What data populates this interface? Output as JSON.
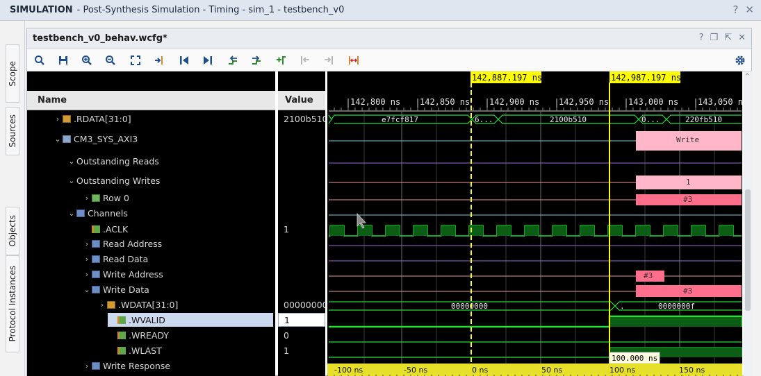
{
  "window": {
    "app": "SIMULATION",
    "rest": "- Post-Synthesis Simulation - Timing - sim_1 - testbench_v0",
    "help": "?",
    "close": "✕"
  },
  "left_tabs": [
    "Scope",
    "Sources",
    "Objects",
    "Protocol Instances"
  ],
  "panel": {
    "title": "testbench_v0_behav.wcfg*",
    "btn_help": "?",
    "btn_restore": "❐",
    "btn_float": "⇱",
    "btn_close": "✕"
  },
  "columns": {
    "name": "Name",
    "value": "Value"
  },
  "rows": [
    {
      "label": ".RDATA[31:0]",
      "value": "2100b510",
      "chevron": "›",
      "icon": "bus"
    },
    {
      "label": "CM3_SYS_AXI3",
      "value": "",
      "chevron": "⌄",
      "icon": "inst"
    },
    {
      "label": "Outstanding Reads",
      "value": "",
      "chevron": "⌄",
      "icon": ""
    },
    {
      "label": "Outstanding Writes",
      "value": "",
      "chevron": "⌄",
      "icon": ""
    },
    {
      "label": "Row 0",
      "value": "",
      "chevron": "›",
      "icon": "rowi"
    },
    {
      "label": "Channels",
      "value": "",
      "chevron": "⌄",
      "icon": "grp"
    },
    {
      "label": ".ACLK",
      "value": "1",
      "chevron": "",
      "icon": "bit"
    },
    {
      "label": "Read Address",
      "value": "",
      "chevron": "›",
      "icon": "grp"
    },
    {
      "label": "Read Data",
      "value": "",
      "chevron": "›",
      "icon": "grp"
    },
    {
      "label": "Write Address",
      "value": "",
      "chevron": "›",
      "icon": "grp"
    },
    {
      "label": "Write Data",
      "value": "",
      "chevron": "⌄",
      "icon": "grp"
    },
    {
      "label": ".WDATA[31:0]",
      "value": "00000000",
      "chevron": "›",
      "icon": "bus"
    },
    {
      "label": ".WVALID",
      "value": "1",
      "chevron": "",
      "icon": "bit",
      "selected": true
    },
    {
      "label": ".WREADY",
      "value": "0",
      "chevron": "",
      "icon": "bit"
    },
    {
      "label": ".WLAST",
      "value": "1",
      "chevron": "",
      "icon": "bit"
    },
    {
      "label": "Write Response",
      "value": "",
      "chevron": "›",
      "icon": "grp"
    }
  ],
  "cursors": {
    "main": "142,887.197 ns",
    "second": "142,987.197 ns",
    "delta": "100.000 ns"
  },
  "time_ticks": [
    "142,800 ns",
    "142,850 ns",
    "142,900 ns",
    "142,950 ns",
    "143,000 ns",
    "143,050 ns"
  ],
  "rel_ticks": [
    "-100 ns",
    "-50 ns",
    "0 ns",
    "50 ns",
    "100 ns",
    "150 ns"
  ],
  "wave_labels": {
    "rdata_a": "e7fcf817",
    "rdata_b": "6...",
    "rdata_c": "2100b510",
    "rdata_d": "0...",
    "rdata_e": "220fb510",
    "write_tx": "Write",
    "out_writes": "1",
    "row0": "#3",
    "wa": "#3",
    "wd": "#3",
    "wdata_a": "00000000",
    "wdata_b": ".",
    "wdata_c": "0000000f"
  },
  "colors": {
    "cursor": "#ffff00",
    "bus": "#22e03a",
    "transaction": "#ffb6c8",
    "transaction_dark": "#ff6f8c"
  }
}
